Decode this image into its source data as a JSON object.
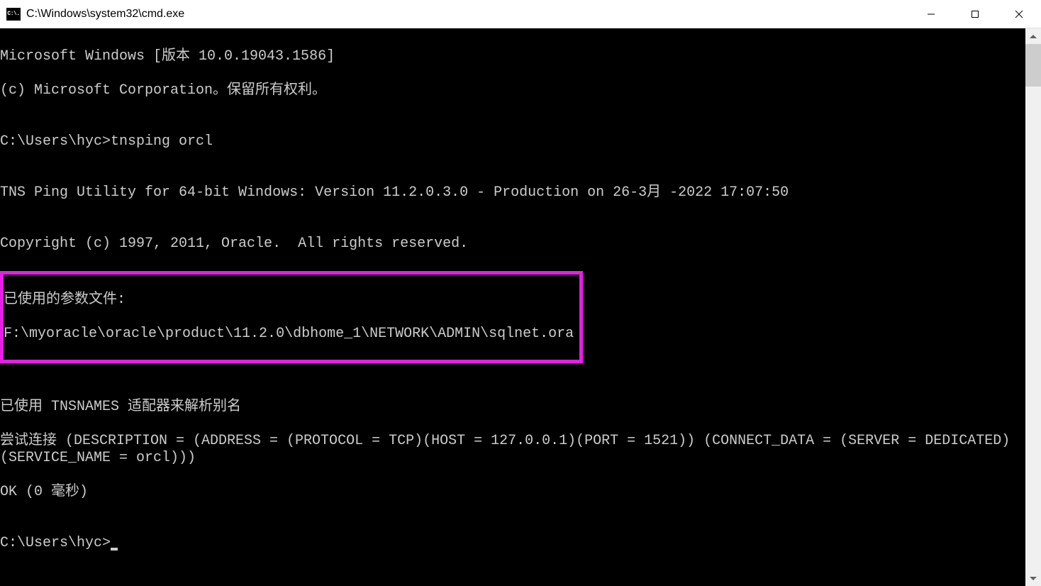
{
  "window": {
    "icon_label": "C:\\.",
    "title": "C:\\Windows\\system32\\cmd.exe"
  },
  "terminal": {
    "line1": "Microsoft Windows [版本 10.0.19043.1586]",
    "line2": "(c) Microsoft Corporation。保留所有权利。",
    "blank1": "",
    "prompt1": "C:\\Users\\hyc>tnsping orcl",
    "blank2": "",
    "tns_header": "TNS Ping Utility for 64-bit Windows: Version 11.2.0.3.0 - Production on 26-3月 -2022 17:07:50",
    "blank3": "",
    "copyright": "Copyright (c) 1997, 2011, Oracle.  All rights reserved.",
    "blank4": "",
    "hl_line1": "已使用的参数文件:",
    "hl_line2": "F:\\myoracle\\oracle\\product\\11.2.0\\dbhome_1\\NETWORK\\ADMIN\\sqlnet.ora",
    "blank5": "",
    "blank6": "",
    "adapter": "已使用 TNSNAMES 适配器来解析别名",
    "attempt": "尝试连接 (DESCRIPTION = (ADDRESS = (PROTOCOL = TCP)(HOST = 127.0.0.1)(PORT = 1521)) (CONNECT_DATA = (SERVER = DEDICATED) (SERVICE_NAME = orcl)))",
    "ok": "OK (0 毫秒)",
    "blank7": "",
    "prompt2": "C:\\Users\\hyc>"
  },
  "highlight_color": "#e61ee6"
}
